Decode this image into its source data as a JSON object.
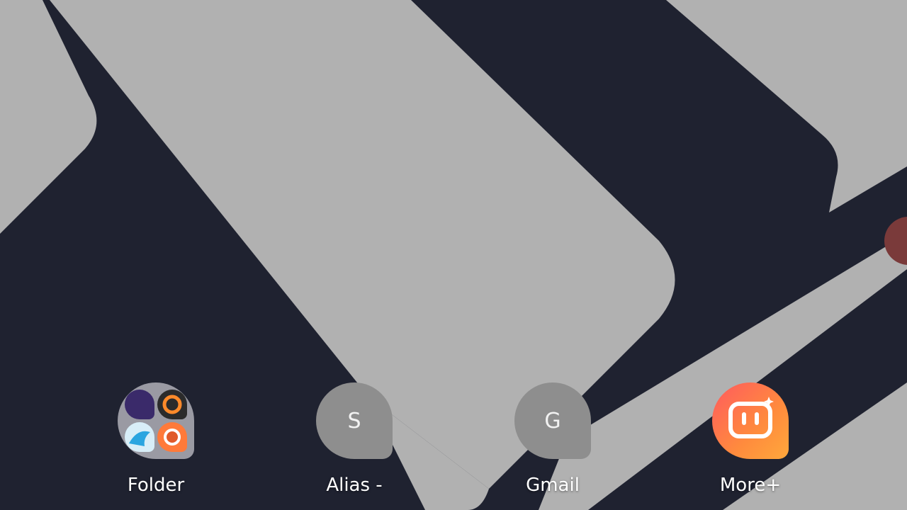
{
  "home_screen": {
    "apps": [
      {
        "label": "Folder",
        "icon": "folder-icon"
      },
      {
        "label": "Alias -",
        "letter": "S",
        "icon": "alias-icon"
      },
      {
        "label": "Gmail",
        "letter": "G",
        "icon": "gmail-icon"
      },
      {
        "label": "More+",
        "icon": "more-plus-app-icon"
      }
    ],
    "colors": {
      "wallpaper_dark": "#1f2230",
      "wallpaper_light": "#b4b4b4",
      "accent": "#7a3a3a",
      "more_gradient_start": "#ff5a5f",
      "more_gradient_end": "#ffa83c"
    }
  }
}
